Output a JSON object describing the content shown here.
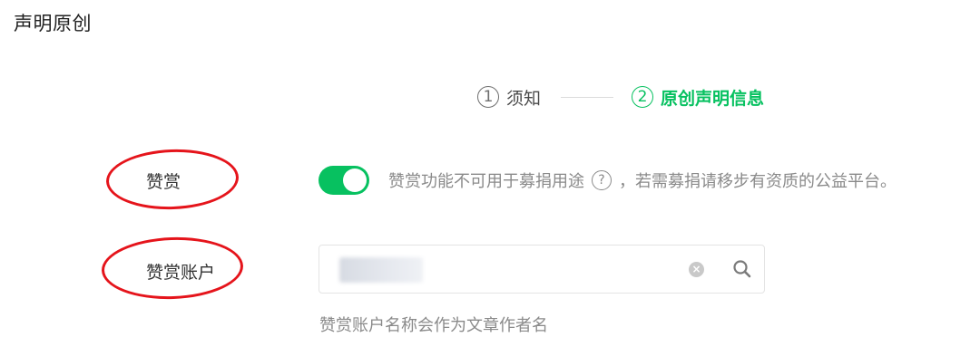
{
  "dialog": {
    "title": "声明原创"
  },
  "steps": [
    {
      "number": "1",
      "label": "须知",
      "state": "inactive"
    },
    {
      "number": "2",
      "label": "原创声明信息",
      "state": "active"
    }
  ],
  "colors": {
    "accent": "#07c160",
    "annotation": "#e5141b"
  },
  "form": {
    "appreciate": {
      "label": "赞赏",
      "toggle_on": true,
      "notice_before": "赞赏功能不可用于募捐用途",
      "help_symbol": "?",
      "notice_after": "，若需募捐请移步有资质的公益平台。"
    },
    "account": {
      "label": "赞赏账户",
      "value": "",
      "hint": "赞赏账户名称会作为文章作者名"
    }
  },
  "icons": {
    "clear": "clear-circle-icon",
    "search": "search-icon",
    "help": "question-circle-icon"
  }
}
